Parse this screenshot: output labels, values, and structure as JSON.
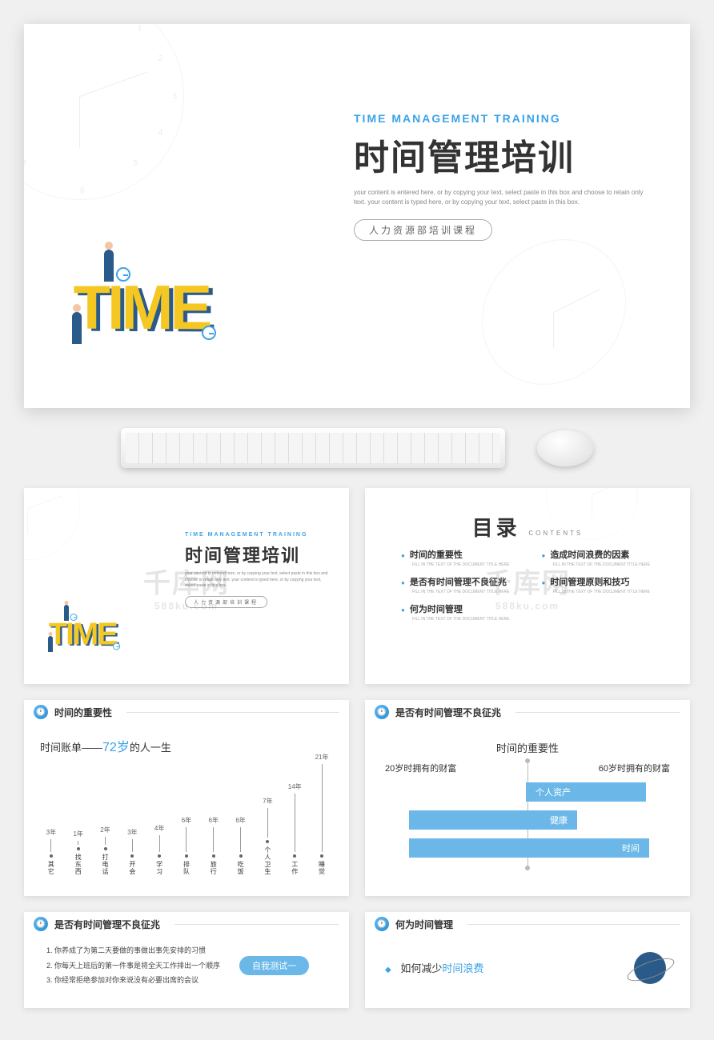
{
  "main": {
    "subtitle_en": "TIME MANAGEMENT TRAINING",
    "title_cn": "时间管理培训",
    "desc": "your content is entered here, or by copying your text, select paste in this box and choose to retain only text. your content is typed here, or by copying your text, select paste in this box.",
    "badge": "人力资源部培训课程",
    "time_word": "TIME"
  },
  "watermark": {
    "main": "千库网",
    "sub": "588ku.com"
  },
  "toc": {
    "title": "目录",
    "title_en": "CONTENTS",
    "items": [
      {
        "h": "时间的重要性",
        "s": "FILL IN THE TEXT OF THE DOCUMENT TITLE HERE"
      },
      {
        "h": "造成时间浪费的因素",
        "s": "FILL IN THE TEXT OF THE DOCUMENT TITLE HERE"
      },
      {
        "h": "是否有时间管理不良征兆",
        "s": "FILL IN THE TEXT OF THE DOCUMENT TITLE HERE"
      },
      {
        "h": "时间管理原则和技巧",
        "s": "FILL IN THE TEXT OF THE DOCUMENT TITLE HERE"
      },
      {
        "h": "何为时间管理",
        "s": "FILL IN THE TEXT OF THE DOCUMENT TITLE HERE"
      }
    ]
  },
  "slide3": {
    "header": "时间的重要性",
    "title_a": "时间账单——",
    "title_hl": "72岁",
    "title_b": "的人一生"
  },
  "chart_data": {
    "type": "bar",
    "title": "时间账单——72岁的人一生",
    "xlabel": "",
    "ylabel": "年",
    "categories": [
      "其它",
      "找东西",
      "打电话",
      "开会",
      "学习",
      "排队",
      "旅行",
      "吃饭",
      "个人卫生",
      "工作",
      "睡觉"
    ],
    "values": [
      3,
      1,
      2,
      3,
      4,
      6,
      6,
      6,
      7,
      14,
      21
    ],
    "ylim": [
      0,
      21
    ]
  },
  "slide4": {
    "header": "是否有时间管理不良征兆",
    "top": "时间的重要性",
    "left_label": "20岁时拥有的财富",
    "right_label": "60岁时拥有的财富",
    "arrows": [
      "个人资产",
      "健康",
      "时间"
    ]
  },
  "slide5": {
    "header": "是否有时间管理不良征兆",
    "badge": "自我测试一",
    "items": [
      "你养成了为第二天要做的事做出事先安排的习惯",
      "你每天上班后的第一件事是将全天工作排出一个顺序",
      "你经常拒绝参加对你来说没有必要出席的会议"
    ]
  },
  "slide6": {
    "header": "何为时间管理",
    "line_a": "如何减少",
    "line_hl": "时间浪费"
  }
}
